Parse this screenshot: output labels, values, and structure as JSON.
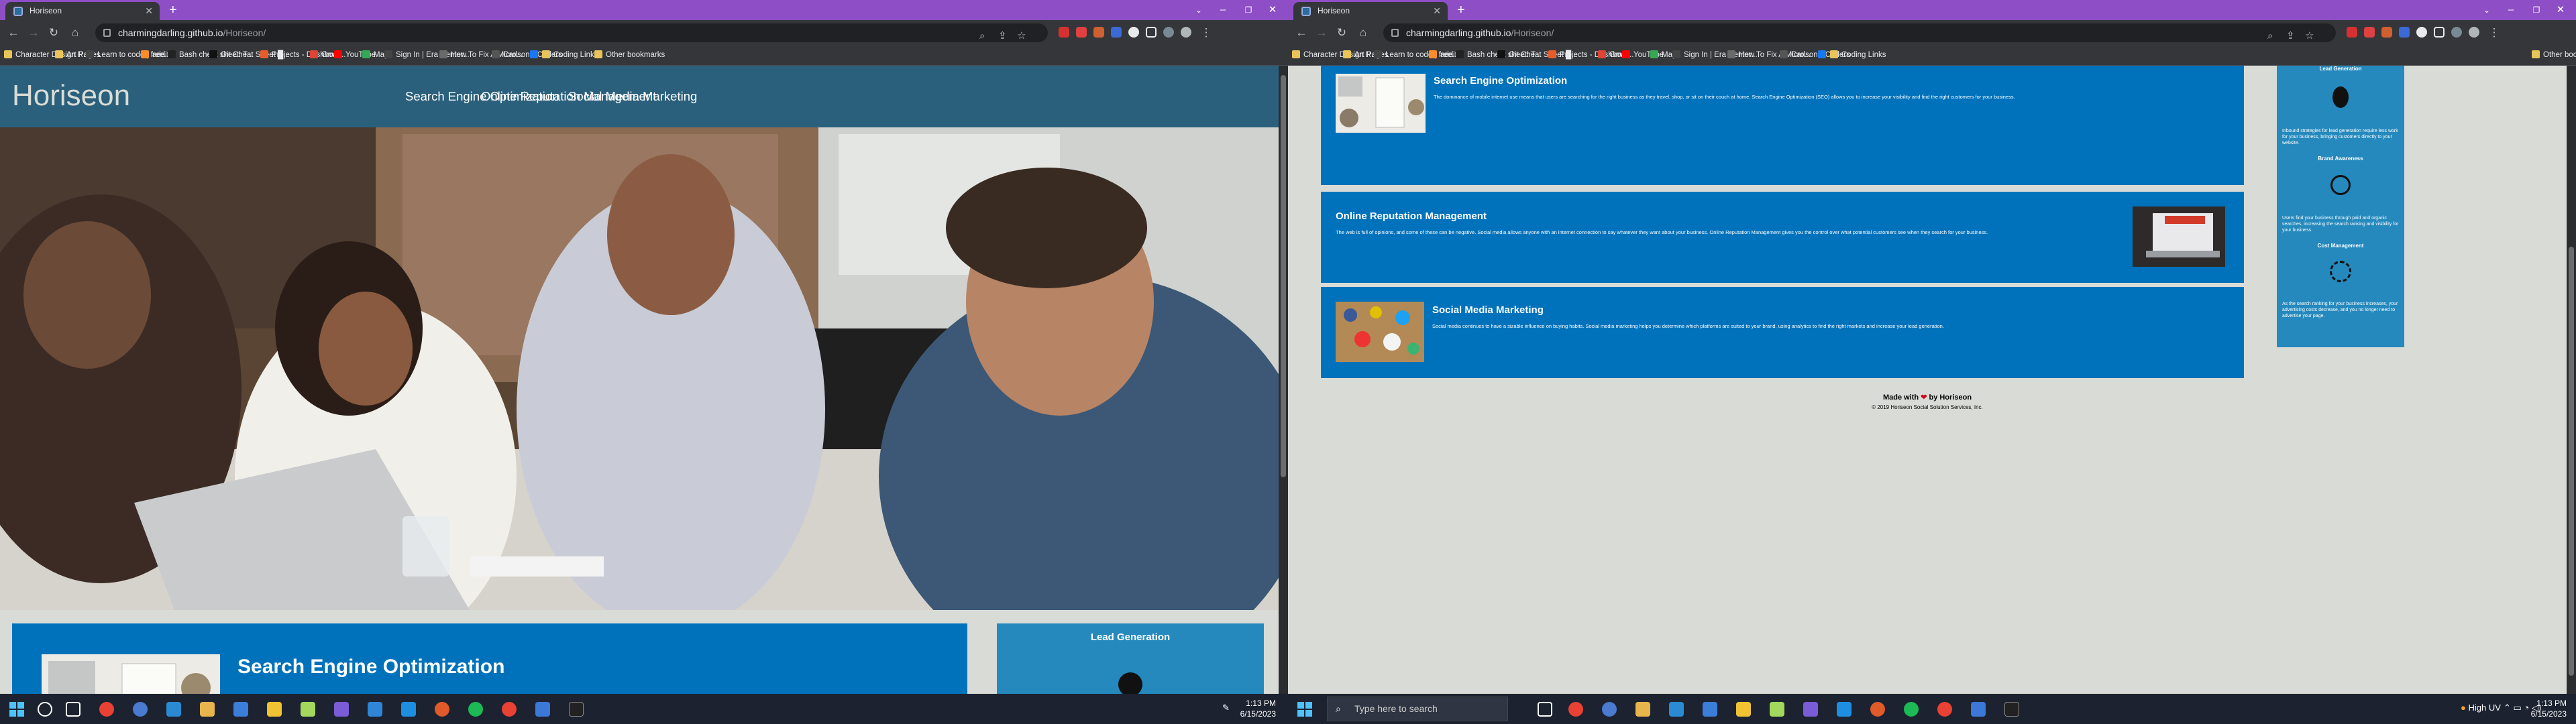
{
  "browser": {
    "tab_title": "Horiseon",
    "url_host": "charmingdarling.github.io",
    "url_path": "/Horiseon/",
    "bookmarks": [
      "Character Design R...",
      "Art Pages",
      "Learn to code | free...",
      "addit",
      "Bash cheat sheet: T...",
      "Git Cheat Sheet █...",
      "Projects - Dashboar...",
      "Gmail",
      "YouTube",
      "Maps",
      "Sign In | Era Center...",
      "How To Fix A Micro...",
      "Carlson's Coders",
      "Coding Links"
    ],
    "other_bookmarks": "Other bookmarks"
  },
  "site": {
    "logo": "Horiseon",
    "nav": [
      "Search Engine Optimization",
      "Online Reputation Management",
      "Social Media Marketing"
    ]
  },
  "content": [
    {
      "title": "Search Engine Optimization",
      "text": "The dominance of mobile internet use means that users are searching for the right business as they travel, shop, or sit on their couch at home. Search Engine Optimization (SEO) allows you to increase your visibility and find the right customers for your business."
    },
    {
      "title": "Online Reputation Management",
      "text": "The web is full of opinions, and some of these can be negative. Social media allows anyone with an internet connection to say whatever they want about your business. Online Reputation Management gives you the control over what potential customers see when they search for your business."
    },
    {
      "title": "Social Media Marketing",
      "text": "Social media continues to have a sizable influence on buying habits. Social media marketing helps you determine which platforms are suited to your brand, using analytics to find the right markets and increase your lead generation."
    }
  ],
  "benefits": [
    {
      "title": "Lead Generation",
      "text": "Inbound strategies for lead generation require less work for your business, bringing customers directly to your website.",
      "icon": "lightbulb-gear-icon"
    },
    {
      "title": "Brand Awareness",
      "text": "Users find your business through paid and organic searches, increasing the search ranking and visibility for your business.",
      "icon": "broadcast-person-icon"
    },
    {
      "title": "Cost Management",
      "text": "As the search ranking for your business increases, your advertising costs decrease, and you no longer need to advertise your page.",
      "icon": "gears-dollar-icon"
    }
  ],
  "footer": {
    "made_with": "Made with",
    "by": "by Horiseon",
    "copyright": "© 2019 Horiseon Social Solution Services, Inc."
  },
  "taskbar": {
    "search_placeholder": "Type here to search",
    "time": "1:13 PM",
    "date": "6/15/2023",
    "weather": "High UV"
  },
  "colors": {
    "header": "#2a607c",
    "card": "#0072bb",
    "benefits": "#2589bd",
    "page_bg": "#d9dcd6",
    "tabstrip": "#8e4ec6"
  }
}
